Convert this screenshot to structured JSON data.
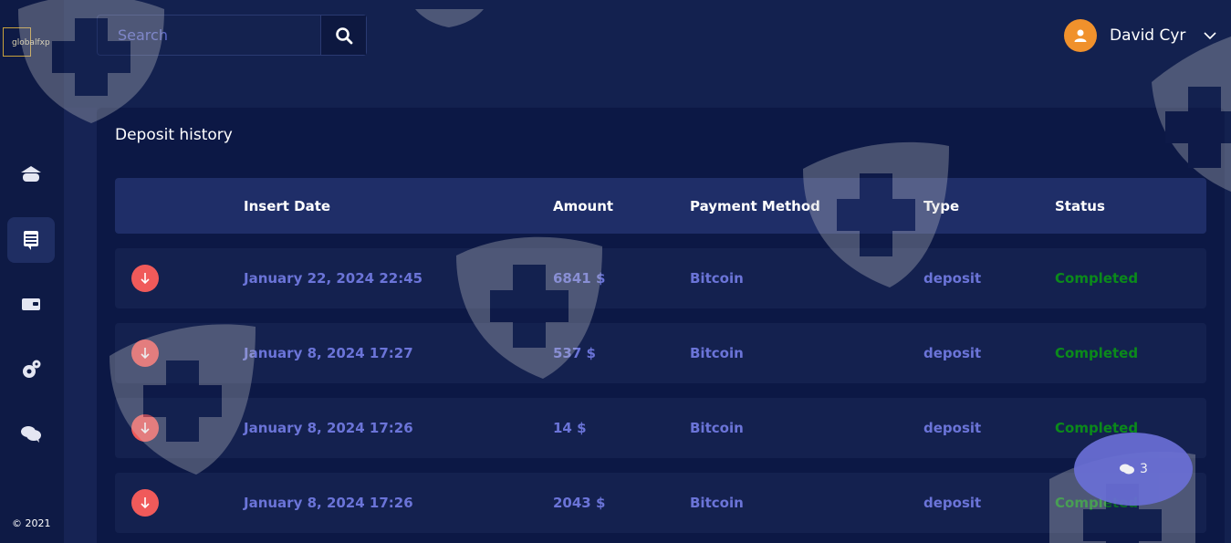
{
  "brand": {
    "logo_text": "globalfxp",
    "copyright": "© 2021"
  },
  "search": {
    "placeholder": "Search",
    "value": ""
  },
  "user": {
    "name": "David Cyr"
  },
  "sidebar": {
    "items": [
      {
        "name": "dashboard",
        "icon": "bank-icon"
      },
      {
        "name": "history",
        "icon": "document-list-icon",
        "active": true
      },
      {
        "name": "wallet",
        "icon": "wallet-icon"
      },
      {
        "name": "settings",
        "icon": "gears-icon"
      },
      {
        "name": "support",
        "icon": "chat-icon"
      }
    ]
  },
  "page": {
    "title": "Deposit history"
  },
  "table": {
    "headers": {
      "insert_date": "Insert Date",
      "amount": "Amount",
      "payment_method": "Payment Method",
      "type": "Type",
      "status": "Status"
    },
    "rows": [
      {
        "date": "January 22, 2024 22:45",
        "amount": "6841 $",
        "method": "Bitcoin",
        "type": "deposit",
        "status": "Completed"
      },
      {
        "date": "January 8, 2024 17:27",
        "amount": "537 $",
        "method": "Bitcoin",
        "type": "deposit",
        "status": "Completed"
      },
      {
        "date": "January 8, 2024 17:26",
        "amount": "14 $",
        "method": "Bitcoin",
        "type": "deposit",
        "status": "Completed"
      },
      {
        "date": "January 8, 2024 17:26",
        "amount": "2043 $",
        "method": "Bitcoin",
        "type": "deposit",
        "status": "Completed"
      }
    ]
  },
  "chat": {
    "count": "3"
  },
  "colors": {
    "background": "#13214f",
    "accent_text": "#6b74d8",
    "status_completed": "#0b8a1b",
    "deposit_badge": "#f05a5a",
    "avatar": "#f0912c"
  }
}
